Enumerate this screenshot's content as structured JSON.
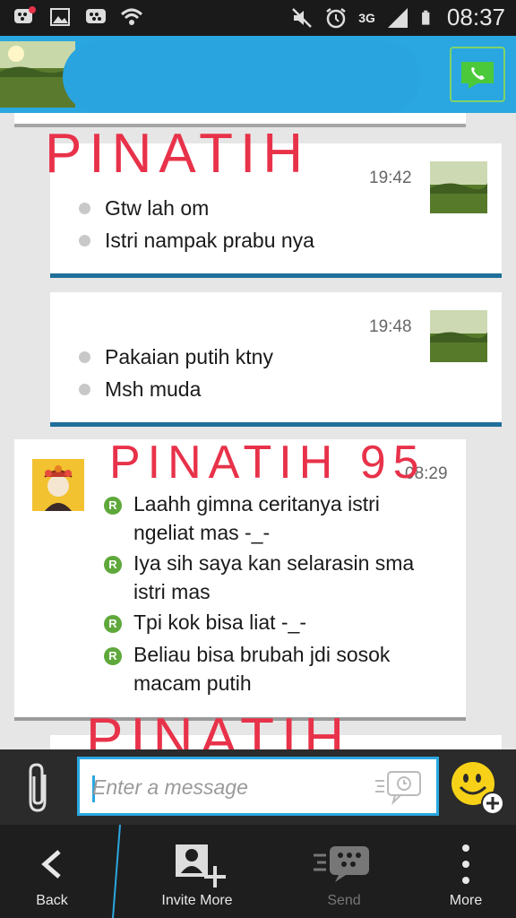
{
  "status_bar": {
    "time": "08:37",
    "network": "3G",
    "icons": [
      "bbm-notification-icon",
      "gallery-icon",
      "bbm-icon",
      "wifi-icon",
      "mute-icon",
      "alarm-icon",
      "signal-icon",
      "battery-icon"
    ]
  },
  "header": {
    "contact_name_hidden": "",
    "call_icon": "phone-call-icon",
    "colors": {
      "bar": "#2aa7e0",
      "call_border": "#7fd36a"
    }
  },
  "annotations": {
    "mark1": "PINATIH",
    "mark2": "PINATIH 95",
    "mark3": "PINATIH"
  },
  "messages": [
    {
      "side": "mine",
      "time": "19:42",
      "lines": [
        "Gtw lah om",
        "Istri nampak prabu nya"
      ]
    },
    {
      "side": "mine",
      "time": "19:48",
      "lines": [
        "Pakaian putih ktny",
        "Msh muda"
      ]
    },
    {
      "side": "theirs",
      "time": "08:29",
      "badge": "R",
      "lines": [
        [
          "Laahh gimna ceritanya istri",
          "ngeliat mas -_-"
        ],
        [
          "Iya sih saya kan selarasin sma",
          "istri mas"
        ],
        [
          "Tpi kok bisa liat -_-"
        ],
        [
          "Beliau bisa brubah jdi sosok",
          "macam putih"
        ]
      ]
    }
  ],
  "composer": {
    "placeholder": "Enter a message",
    "attach_icon": "paperclip-icon",
    "emoji_icon": "smiley-add-icon",
    "voice_icon": "voice-note-icon"
  },
  "nav": {
    "back": "Back",
    "invite": "Invite More",
    "send": "Send",
    "more": "More"
  }
}
